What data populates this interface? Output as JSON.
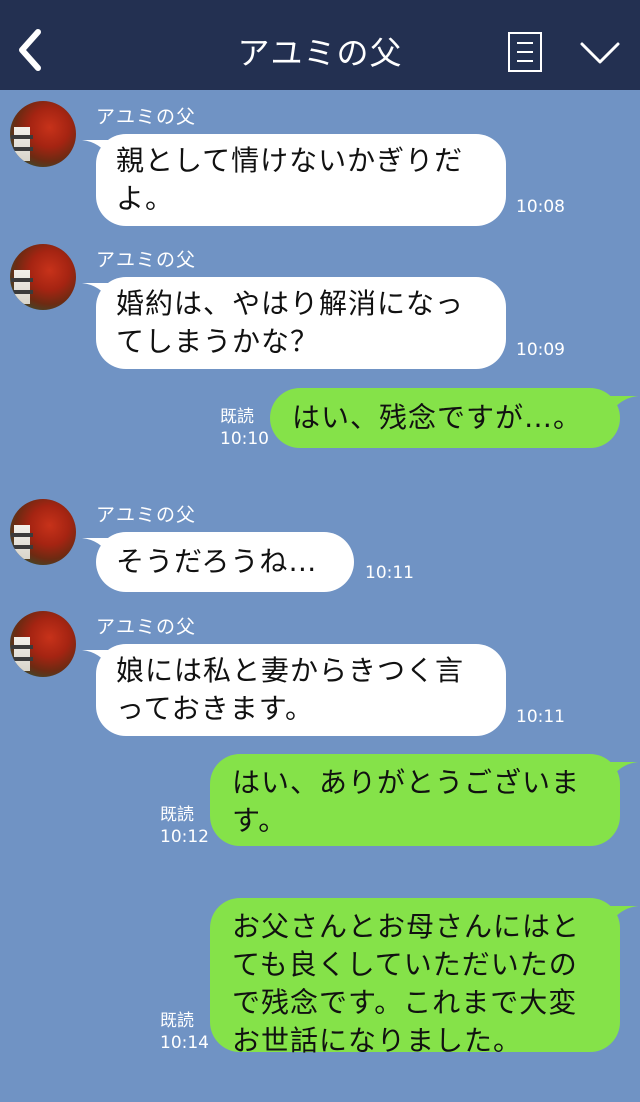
{
  "header": {
    "title": "アユミの父"
  },
  "messages": [
    {
      "side": "left",
      "name": "アユミの父",
      "text": "親として情けないかぎりだよ。",
      "time": "10:08"
    },
    {
      "side": "left",
      "name": "アユミの父",
      "text": "婚約は、やはり解消になってしまうかな？",
      "time": "10:09"
    },
    {
      "side": "right",
      "read": "既読",
      "text": "はい、残念ですが…。",
      "time": "10:10"
    },
    {
      "side": "left",
      "name": "アユミの父",
      "text": "そうだろうね…",
      "time": "10:11"
    },
    {
      "side": "left",
      "name": "アユミの父",
      "text": "娘には私と妻からきつく言っておきます。",
      "time": "10:11"
    },
    {
      "side": "right",
      "read": "既読",
      "text": "はい、ありがとうございます。",
      "time": "10:12"
    },
    {
      "side": "right",
      "read": "既読",
      "text": "お父さんとお母さんにはとても良くしていただいたので残念です。これまで大変お世話になりました。",
      "time": "10:14"
    }
  ],
  "colors": {
    "background": "#7093c4",
    "header": "#233051",
    "incoming_bubble": "#ffffff",
    "outgoing_bubble": "#85e249"
  },
  "icons": [
    "chevron-left-icon",
    "menu-list-icon",
    "chevron-down-icon"
  ]
}
